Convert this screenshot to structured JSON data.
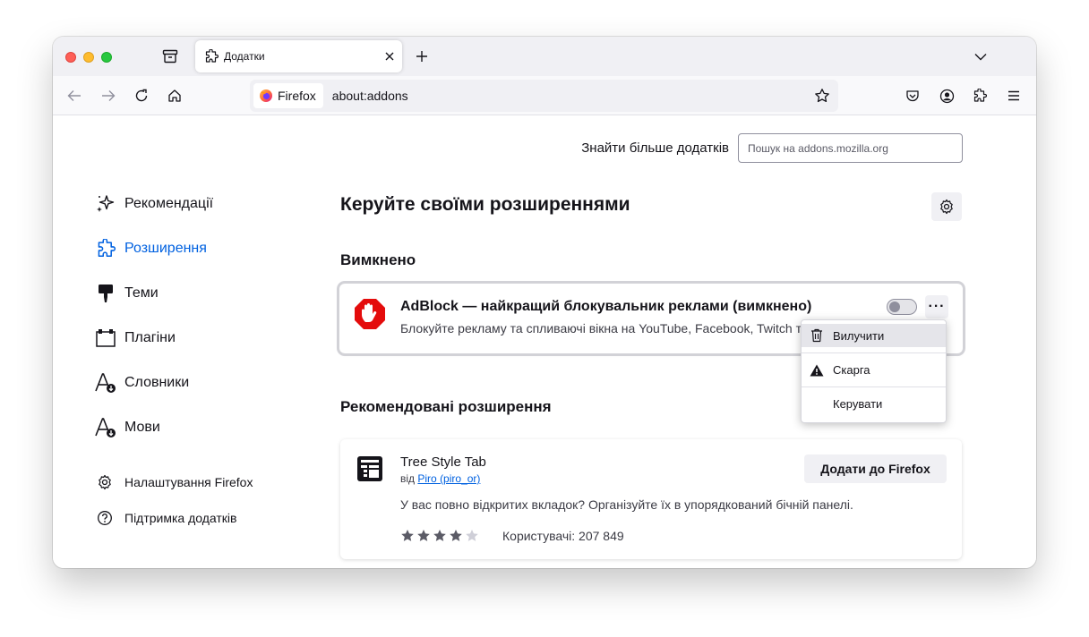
{
  "tab": {
    "title": "Додатки"
  },
  "urlbar": {
    "identity": "Firefox",
    "url": "about:addons"
  },
  "header": {
    "find_more_label": "Знайти більше додатків",
    "search_placeholder": "Пошук на addons.mozilla.org"
  },
  "sidebar": {
    "categories": [
      {
        "label": "Рекомендації",
        "icon": "sparkle-icon"
      },
      {
        "label": "Розширення",
        "icon": "puzzle-icon",
        "selected": true
      },
      {
        "label": "Теми",
        "icon": "paintbrush-icon"
      },
      {
        "label": "Плагіни",
        "icon": "plugin-icon"
      },
      {
        "label": "Словники",
        "icon": "dictionary-icon"
      },
      {
        "label": "Мови",
        "icon": "language-icon"
      }
    ],
    "footer": [
      {
        "label": "Налаштування Firefox",
        "icon": "gear-icon"
      },
      {
        "label": "Підтримка додатків",
        "icon": "help-icon"
      }
    ]
  },
  "main": {
    "heading": "Керуйте своїми розширеннями",
    "disabled_heading": "Вимкнено",
    "recommended_heading": "Рекомендовані розширення"
  },
  "addon": {
    "name": "AdBlock — найкращий блокувальник реклами (вимкнено)",
    "description": "Блокуйте рекламу та спливаючі вікна на YouTube, Facebook, Twitch та ваших улюблених сайтах.",
    "enabled": false,
    "more_label": "···"
  },
  "menu": {
    "items": [
      "Вилучити",
      "Скарга",
      "Керувати"
    ]
  },
  "recommended": {
    "name": "Tree Style Tab",
    "by_prefix": "від",
    "author": "Piro (piro_or)",
    "description": "У вас повно відкритих вкладок? Організуйте їх в упорядкований бічній панелі.",
    "rating": 4.5,
    "users": "Користувачі: 207 849",
    "add_label": "Додати до Firefox"
  },
  "colors": {
    "accent": "#0061e0",
    "adblock_red": "#e40c0c"
  }
}
